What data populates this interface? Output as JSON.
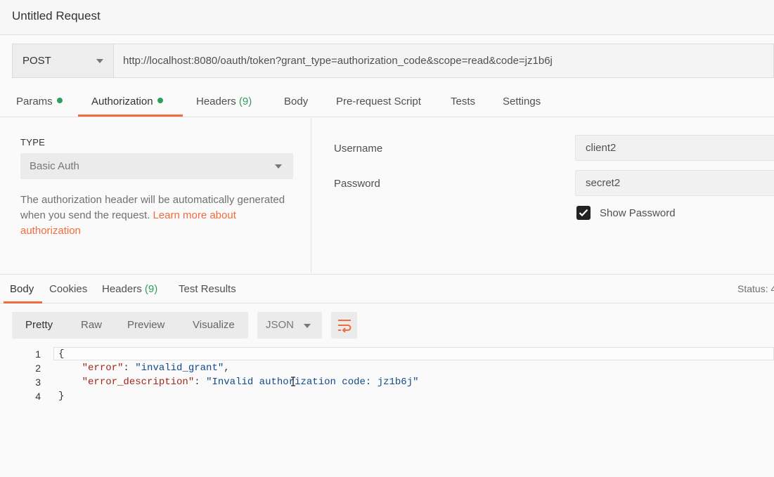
{
  "request": {
    "title": "Untitled Request",
    "method": "POST",
    "url": "http://localhost:8080/oauth/token?grant_type=authorization_code&scope=read&code=jz1b6j"
  },
  "req_tabs": {
    "params": "Params",
    "authorization": "Authorization",
    "headers": "Headers",
    "headers_count": "(9)",
    "body": "Body",
    "prerequest": "Pre-request Script",
    "tests": "Tests",
    "settings": "Settings"
  },
  "auth": {
    "type_label": "TYPE",
    "type_value": "Basic Auth",
    "description": "The authorization header will be automatically generated when you send the request. ",
    "learn_more": "Learn more about authorization",
    "username_label": "Username",
    "username_value": "client2",
    "password_label": "Password",
    "password_value": "secret2",
    "show_password_label": "Show Password",
    "show_password_checked": true
  },
  "resp_tabs": {
    "body": "Body",
    "cookies": "Cookies",
    "headers": "Headers",
    "headers_count": "(9)",
    "test_results": "Test Results",
    "status": "Status: 4"
  },
  "response_view": {
    "pretty": "Pretty",
    "raw": "Raw",
    "preview": "Preview",
    "visualize": "Visualize",
    "format": "JSON"
  },
  "response_body": {
    "line_numbers": [
      "1",
      "2",
      "3",
      "4"
    ],
    "open_brace": "{",
    "close_brace": "}",
    "key1": "\"error\"",
    "val1": "\"invalid_grant\"",
    "key2": "\"error_description\"",
    "val2": "\"Invalid authorization code: jz1b6j\""
  },
  "colors": {
    "accent": "#f26b3a",
    "dot_green": "#2f9e5c"
  }
}
